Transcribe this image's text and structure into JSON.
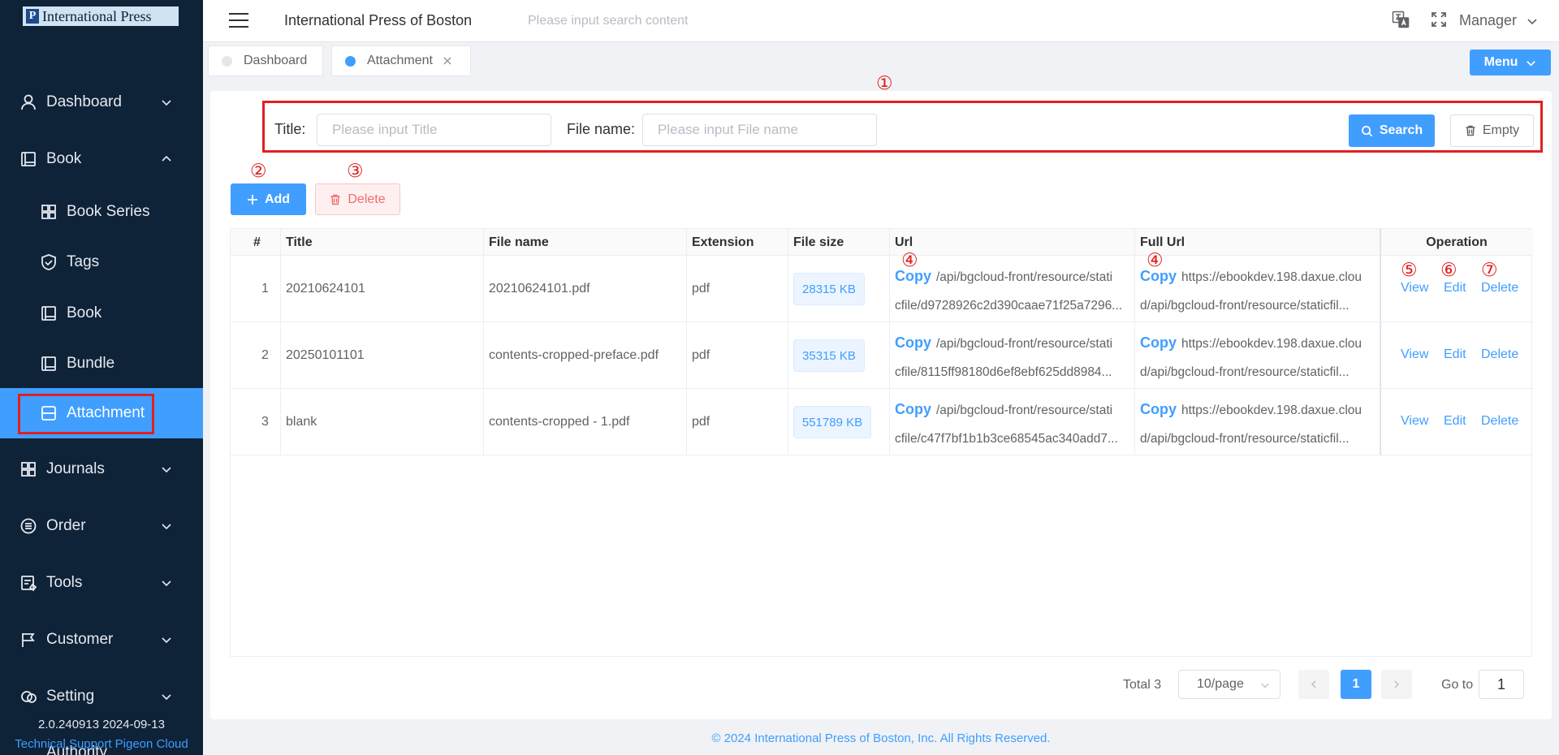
{
  "sidebar": {
    "logo_text": "International Press",
    "items": [
      {
        "label": "Dashboard",
        "icon": "user-icon"
      },
      {
        "label": "Book",
        "icon": "book-icon"
      },
      {
        "label": "Book Series",
        "icon": "grid-icon"
      },
      {
        "label": "Tags",
        "icon": "shield-icon"
      },
      {
        "label": "Book",
        "icon": "book-icon"
      },
      {
        "label": "Bundle",
        "icon": "book-icon"
      },
      {
        "label": "Attachment",
        "icon": "attachment-icon"
      },
      {
        "label": "Journals",
        "icon": "grid-icon"
      },
      {
        "label": "Order",
        "icon": "list-icon"
      },
      {
        "label": "Tools",
        "icon": "tools-icon"
      },
      {
        "label": "Customer",
        "icon": "flag-icon"
      },
      {
        "label": "Setting",
        "icon": "setting-icon"
      },
      {
        "label": "Authority",
        "icon": "lock-icon"
      }
    ],
    "version": "2.0.240913 2024-09-13",
    "support": "Technical Support Pigeon Cloud"
  },
  "header": {
    "title": "International Press of Boston",
    "search_placeholder": "Please input search content",
    "user": "Manager"
  },
  "tabs": [
    {
      "label": "Dashboard",
      "active": false
    },
    {
      "label": "Attachment",
      "active": true
    }
  ],
  "menu_label": "Menu",
  "filter": {
    "title_label": "Title:",
    "title_placeholder": "Please input Title",
    "filename_label": "File name:",
    "filename_placeholder": "Please input File name",
    "search_label": "Search",
    "empty_label": "Empty"
  },
  "actions": {
    "add": "Add",
    "delete": "Delete"
  },
  "markers": [
    "①",
    "②",
    "③",
    "④",
    "④",
    "⑤",
    "⑥",
    "⑦"
  ],
  "table": {
    "columns": [
      "#",
      "Title",
      "File name",
      "Extension",
      "File size",
      "Url",
      "Full Url",
      "Operation"
    ],
    "copy_label": "Copy",
    "ops": [
      "View",
      "Edit",
      "Delete"
    ],
    "rows": [
      {
        "no": "1",
        "title": "20210624101",
        "filename": "20210624101.pdf",
        "ext": "pdf",
        "size": "28315 KB",
        "url1": "/api/bgcloud-front/resource/stati",
        "url2": "cfile/d9728926c2d390caae71f25a7296...",
        "full1": "https://ebookdev.198.daxue.clou",
        "full2": "d/api/bgcloud-front/resource/staticfil..."
      },
      {
        "no": "2",
        "title": "20250101101",
        "filename": "contents-cropped-preface.pdf",
        "ext": "pdf",
        "size": "35315 KB",
        "url1": "/api/bgcloud-front/resource/stati",
        "url2": "cfile/8115ff98180d6ef8ebf625dd8984...",
        "full1": "https://ebookdev.198.daxue.clou",
        "full2": "d/api/bgcloud-front/resource/staticfil..."
      },
      {
        "no": "3",
        "title": "blank",
        "filename": "contents-cropped - 1.pdf",
        "ext": "pdf",
        "size": "551789 KB",
        "url1": "/api/bgcloud-front/resource/stati",
        "url2": "cfile/c47f7bf1b1b3ce68545ac340add7...",
        "full1": "https://ebookdev.198.daxue.clou",
        "full2": "d/api/bgcloud-front/resource/staticfil..."
      }
    ]
  },
  "pagination": {
    "total": "Total 3",
    "page_size": "10/page",
    "current": "1",
    "goto_label": "Go to",
    "goto_value": "1"
  },
  "footer": "© 2024 International Press of Boston, Inc. All Rights Reserved.",
  "colors": {
    "sidebar_bg": "#0e2238",
    "primary": "#409eff",
    "annotation_red": "#e02020",
    "danger": "#f56c6c"
  }
}
